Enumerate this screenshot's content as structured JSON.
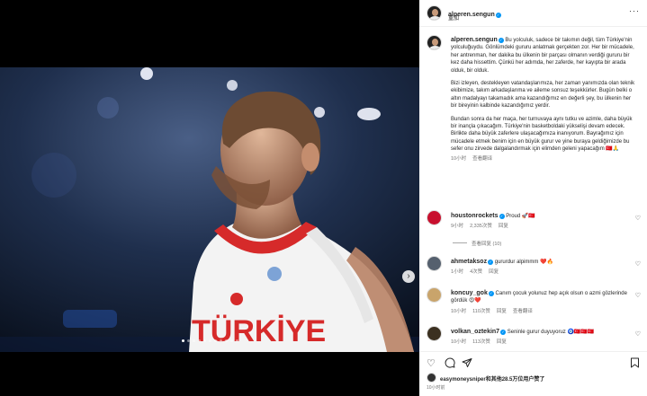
{
  "header": {
    "username": "alperen.sengun",
    "subtitle": "重加",
    "more": "···"
  },
  "caption": {
    "username": "alperen.sengun",
    "paragraphs": [
      "Bu yolculuk, sadece bir takımın değil, tüm Türkiye'nin yolculuğuydu. Gönlümdeki gururu anlatmak gerçekten zor. Her bir mücadele, her antrenman, her dakika bu ülkenin bir parçası olmanın verdiği gururu bir kez daha hissettim. Çünkü her adımda, her zaferde, her kayıpta bir arada olduk, bir olduk.",
      "Bizi izleyen, destekleyen vatandaşlarımıza, her zaman yanımızda olan teknik ekibimize, takım arkadaşlarıma ve aileme sonsuz teşekkürler. Bugün belki o altın madalyayı takamadık ama kazandığımız en değerli şey, bu ülkenin her bir bireyinin kalbinde kazandığımız yerdir.",
      "Bundan sonra da her maça, her turnuvaya aynı tutku ve azimle, daha büyük bir inançla çıkacağım. Türkiye'nin basketboldaki yükselişi devam edecek. Birlikte daha büyük zaferlere ulaşacağımıza inanıyorum. Bayrağımız için mücadele etmek benim için en büyük gurur ve yine buraya geldiğimizde bu sefer onu zirvede dalgalandırmak için elimden geleni yapacağım 🇹🇷🙏"
    ],
    "time": "10小时",
    "translate": "查看翻译"
  },
  "comments": [
    {
      "username": "houstonrockets",
      "verified": true,
      "text": "Proud 🚀🇹🇷",
      "time": "9小时",
      "likes": "2,335次赞",
      "reply": "回复",
      "view_replies": "查看回复 (10)"
    },
    {
      "username": "ahmetaksoz",
      "verified": true,
      "text": "gururdur alpimmm ❤️🔥",
      "time": "1小时",
      "likes": "4次赞",
      "reply": "回复"
    },
    {
      "username": "koncuy_gok",
      "verified": true,
      "text": "Canım çocuk yolunuz hep açık olsun o azmi gözlerinde gördük 😍❤️",
      "time": "10小时",
      "likes": "110次赞",
      "reply": "回复",
      "translate": "查看翻译"
    },
    {
      "username": "volkan_oztekin7",
      "verified": true,
      "text": "Seninle gurur duyuyoruz 🧿🇹🇷🇹🇷🇹🇷",
      "time": "10小时",
      "likes": "113次赞",
      "reply": "回复"
    }
  ],
  "footer": {
    "likes_text": "easymoneysniper和其他28.5万位用户赞了",
    "time": "10小时前"
  },
  "media": {
    "jersey_text": "TÜRKİYE",
    "carousel_count": 11,
    "active_index": 0
  },
  "colors": {
    "verified": "#0095f6",
    "jersey_red": "#d62a2a",
    "muted": "#737373"
  }
}
